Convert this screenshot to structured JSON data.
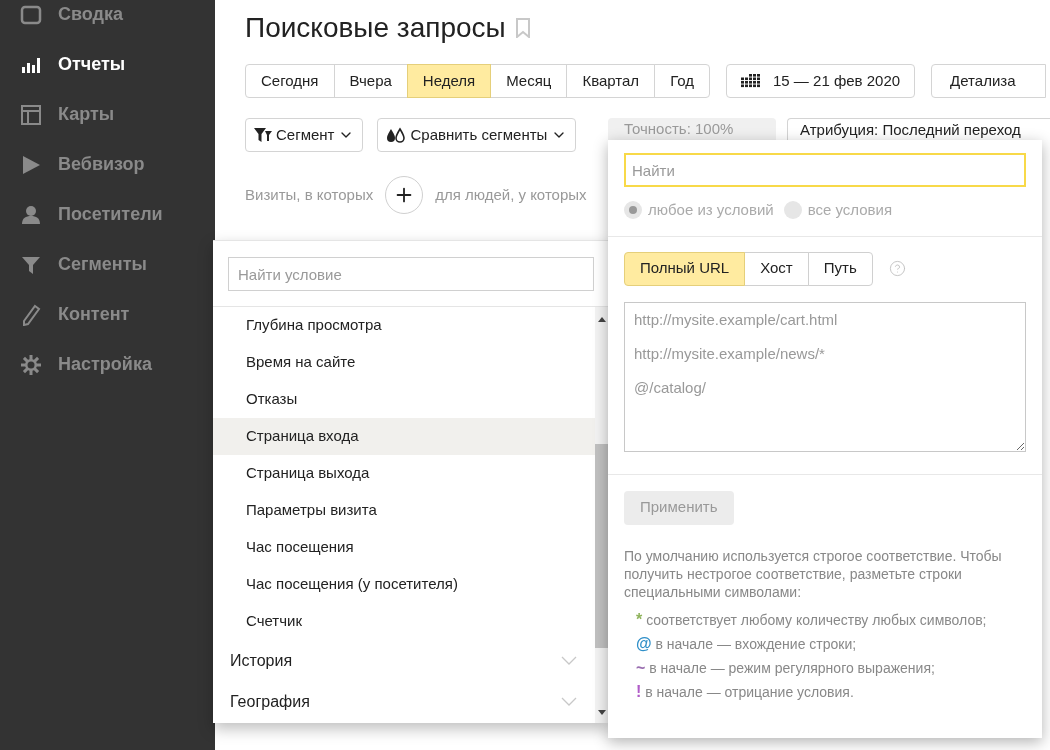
{
  "sidebar": {
    "items": [
      {
        "label": "Сводка",
        "selected": false
      },
      {
        "label": "Отчеты",
        "selected": true
      },
      {
        "label": "Карты",
        "selected": false
      },
      {
        "label": "Вебвизор",
        "selected": false
      },
      {
        "label": "Посетители",
        "selected": false
      },
      {
        "label": "Сегменты",
        "selected": false
      },
      {
        "label": "Контент",
        "selected": false
      },
      {
        "label": "Настройка",
        "selected": false
      }
    ]
  },
  "page": {
    "title": "Поисковые запросы"
  },
  "periods": [
    {
      "label": "Сегодня",
      "selected": false
    },
    {
      "label": "Вчера",
      "selected": false
    },
    {
      "label": "Неделя",
      "selected": true
    },
    {
      "label": "Месяц",
      "selected": false
    },
    {
      "label": "Квартал",
      "selected": false
    },
    {
      "label": "Год",
      "selected": false
    }
  ],
  "date_range": "15 — 21 фев 2020",
  "detail_button": "Детализа",
  "filters": {
    "segment": "Сегмент",
    "compare": "Сравнить сегменты",
    "accuracy": "Точность: 100%",
    "attribution": "Атрибуция: Последний переход"
  },
  "condition_row": {
    "left": "Визиты, в которых",
    "right": "для людей, у которых"
  },
  "condition_menu": {
    "search_placeholder": "Найти условие",
    "items": [
      {
        "kind": "item",
        "label": "Глубина просмотра",
        "selected": false
      },
      {
        "kind": "item",
        "label": "Время на сайте",
        "selected": false
      },
      {
        "kind": "item",
        "label": "Отказы",
        "selected": false
      },
      {
        "kind": "item",
        "label": "Страница входа",
        "selected": true
      },
      {
        "kind": "item",
        "label": "Страница выхода",
        "selected": false
      },
      {
        "kind": "item",
        "label": "Параметры визита",
        "selected": false
      },
      {
        "kind": "item",
        "label": "Час посещения",
        "selected": false
      },
      {
        "kind": "item",
        "label": "Час посещения (у посетителя)",
        "selected": false
      },
      {
        "kind": "item",
        "label": "Счетчик",
        "selected": false
      },
      {
        "kind": "group",
        "label": "История",
        "expanded": false
      },
      {
        "kind": "group",
        "label": "География",
        "expanded": false
      }
    ]
  },
  "url_popup": {
    "search_placeholder": "Найти",
    "match": [
      {
        "label": "любое из условий",
        "selected": true
      },
      {
        "label": "все условия",
        "selected": false
      }
    ],
    "modes": [
      {
        "label": "Полный URL",
        "selected": true
      },
      {
        "label": "Хост",
        "selected": false
      },
      {
        "label": "Путь",
        "selected": false
      }
    ],
    "values_placeholder": "http://mysite.example/cart.html\n\nhttp://mysite.example/news/*\n\n@/catalog/",
    "apply": {
      "label": "Применить",
      "disabled": true
    },
    "help": "По умолчанию используется строгое соответствие. Чтобы получить нестрогое соответствие, разметьте строки специальными символами:",
    "hints": [
      {
        "symbol": "*",
        "color": "#8fb35c",
        "text": "соответствует любому количеству любых символов;"
      },
      {
        "symbol": "@",
        "color": "#2f8fc8",
        "text": "в начале — вхождение строки;"
      },
      {
        "symbol": "~",
        "color": "#9a6fb0",
        "text": "в начале — режим регулярного выражения;"
      },
      {
        "symbol": "!",
        "color": "#b05cc8",
        "text": "в начале — отрицание условия."
      }
    ]
  }
}
